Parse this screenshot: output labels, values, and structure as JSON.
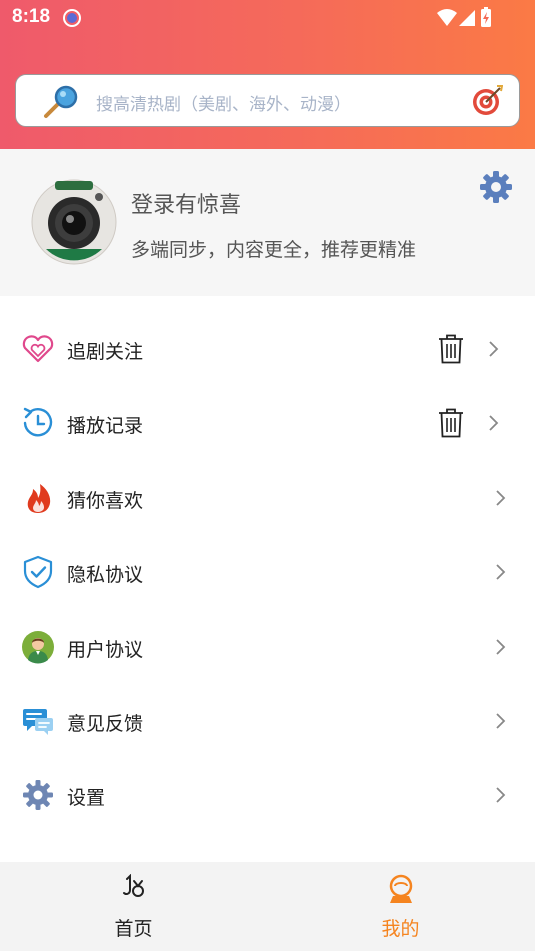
{
  "status_bar": {
    "time": "8:18"
  },
  "search": {
    "placeholder": "搜高清热剧（美剧、海外、动漫）"
  },
  "profile": {
    "title": "登录有惊喜",
    "subtitle": "多端同步，内容更全，推荐更精准"
  },
  "menu": [
    {
      "label": "追剧关注",
      "icon": "heart-icon",
      "has_delete": true
    },
    {
      "label": "播放记录",
      "icon": "history-clock-icon",
      "has_delete": true
    },
    {
      "label": "猜你喜欢",
      "icon": "fire-icon",
      "has_delete": false
    },
    {
      "label": "隐私协议",
      "icon": "shield-check-icon",
      "has_delete": false
    },
    {
      "label": "用户协议",
      "icon": "user-avatar-icon",
      "has_delete": false
    },
    {
      "label": "意见反馈",
      "icon": "feedback-chat-icon",
      "has_delete": false
    },
    {
      "label": "设置",
      "icon": "gear-icon",
      "has_delete": false
    }
  ],
  "tabs": [
    {
      "label": "首页",
      "icon": "home-icon",
      "active": false
    },
    {
      "label": "我的",
      "icon": "profile-icon",
      "active": true
    }
  ],
  "colors": {
    "header_gradient_start": "#ef5a6b",
    "header_gradient_end": "#fb7a45",
    "active_tab": "#f5841f",
    "placeholder": "#a8b4c8"
  }
}
